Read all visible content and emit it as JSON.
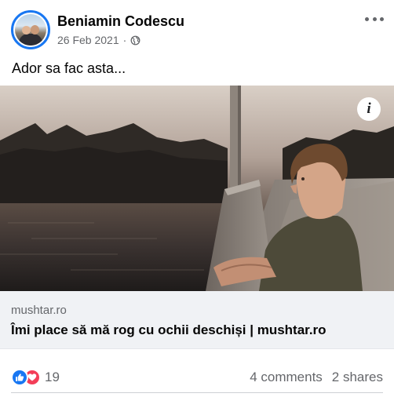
{
  "post": {
    "author": "Beniamin Codescu",
    "date": "26 Feb 2021",
    "separator": "·",
    "privacy_icon": "globe-icon",
    "text": "Ador sa fac asta..."
  },
  "link": {
    "domain": "mushtar.ro",
    "title": "Îmi place să mă rog cu ochii deschiși | mushtar.ro",
    "info_symbol": "i"
  },
  "engagement": {
    "reaction_icons": [
      "like-icon",
      "love-icon"
    ],
    "reaction_count": "19",
    "comments": "4 comments",
    "shares": "2 shares"
  },
  "colors": {
    "accent": "#1877f2",
    "love": "#f33e58",
    "secondary_text": "#65676b",
    "link_background": "#f0f2f5"
  }
}
